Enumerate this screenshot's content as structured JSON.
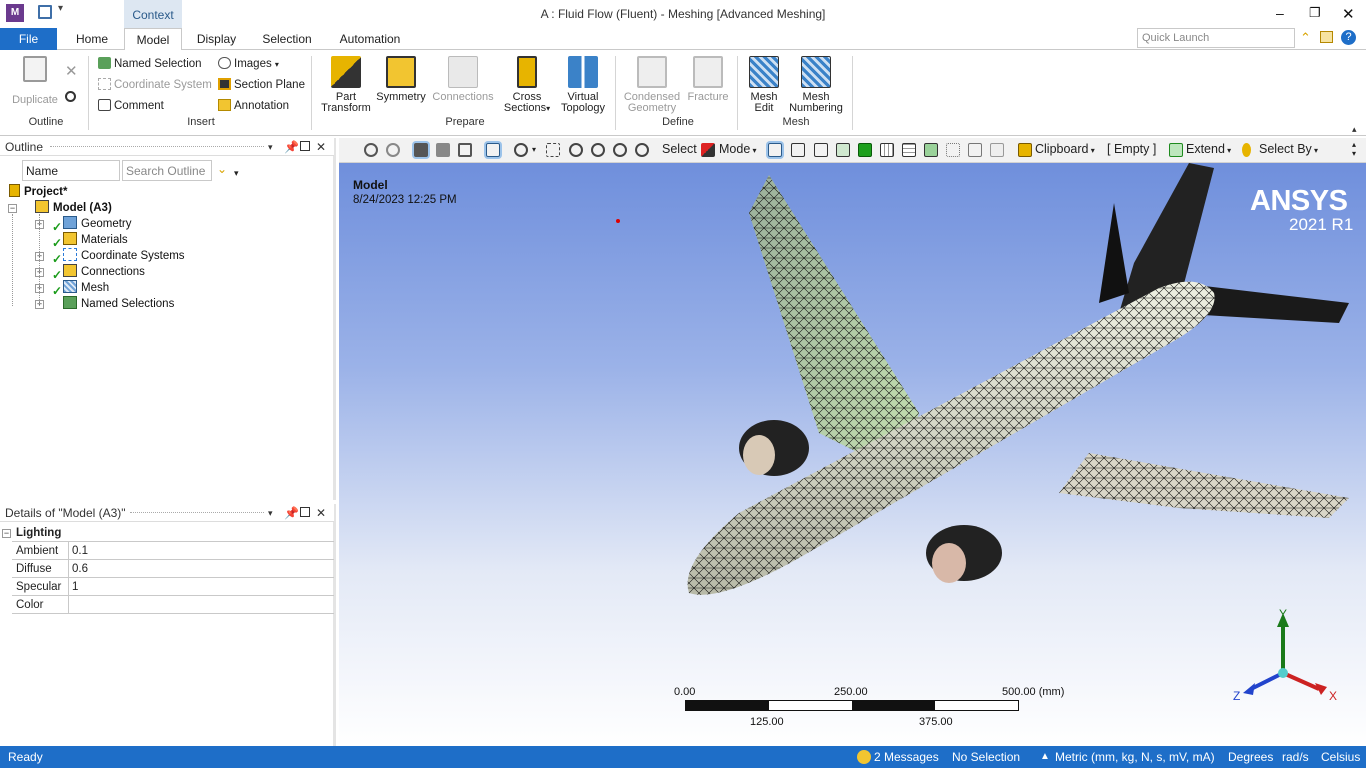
{
  "window": {
    "title": "A : Fluid Flow (Fluent) - Meshing [Advanced Meshing]",
    "app_icon": "M",
    "context_tab": "Context"
  },
  "tabs": [
    {
      "label": "File"
    },
    {
      "label": "Home"
    },
    {
      "label": "Model"
    },
    {
      "label": "Display"
    },
    {
      "label": "Selection"
    },
    {
      "label": "Automation"
    }
  ],
  "quick_launch": {
    "placeholder": "Quick Launch"
  },
  "ribbon": {
    "outline": {
      "duplicate": "Duplicate",
      "group": "Outline"
    },
    "insert": {
      "named_selection": "Named Selection",
      "coordinate_system": "Coordinate System",
      "comment": "Comment",
      "images": "Images",
      "section_plane": "Section Plane",
      "annotation": "Annotation",
      "group": "Insert"
    },
    "prepare": {
      "part_transform_1": "Part",
      "part_transform_2": "Transform",
      "symmetry": "Symmetry",
      "connections": "Connections",
      "cross_sections_1": "Cross",
      "cross_sections_2": "Sections",
      "virtual_topology_1": "Virtual",
      "virtual_topology_2": "Topology",
      "group": "Prepare"
    },
    "define": {
      "condensed_1": "Condensed",
      "condensed_2": "Geometry",
      "fracture": "Fracture",
      "group": "Define"
    },
    "mesh": {
      "mesh_edit_1": "Mesh",
      "mesh_edit_2": "Edit",
      "mesh_numbering_1": "Mesh",
      "mesh_numbering_2": "Numbering",
      "group": "Mesh"
    }
  },
  "outline": {
    "title": "Outline",
    "name_filter": "Name",
    "search_placeholder": "Search Outline",
    "project": "Project*",
    "model": "Model (A3)",
    "items": [
      {
        "label": "Geometry"
      },
      {
        "label": "Materials"
      },
      {
        "label": "Coordinate Systems"
      },
      {
        "label": "Connections"
      },
      {
        "label": "Mesh"
      },
      {
        "label": "Named Selections"
      }
    ]
  },
  "details": {
    "title": "Details of \"Model (A3)\"",
    "section": "Lighting",
    "rows": [
      {
        "key": "Ambient",
        "value": "0.1"
      },
      {
        "key": "Diffuse",
        "value": "0.6"
      },
      {
        "key": "Specular",
        "value": "1"
      },
      {
        "key": "Color",
        "value": ""
      }
    ]
  },
  "toolbar3d": {
    "select": "Select",
    "mode": "Mode",
    "clipboard": "Clipboard",
    "empty": "[ Empty ]",
    "extend": "Extend",
    "select_by": "Select By"
  },
  "viewport": {
    "label": "Model",
    "timestamp": "8/24/2023 12:25 PM",
    "brand": "ANSYS",
    "version": "2021 R1",
    "scale": {
      "t0": "0.00",
      "t250": "250.00",
      "t500": "500.00 (mm)",
      "t125": "125.00",
      "t375": "375.00"
    },
    "axes": {
      "y": "Y",
      "z": "Z",
      "x": "X"
    }
  },
  "status": {
    "ready": "Ready",
    "messages": "2 Messages",
    "selection": "No Selection",
    "units": "Metric (mm, kg, N, s, mV, mA)",
    "angle": "Degrees",
    "rate": "rad/s",
    "temp": "Celsius"
  }
}
